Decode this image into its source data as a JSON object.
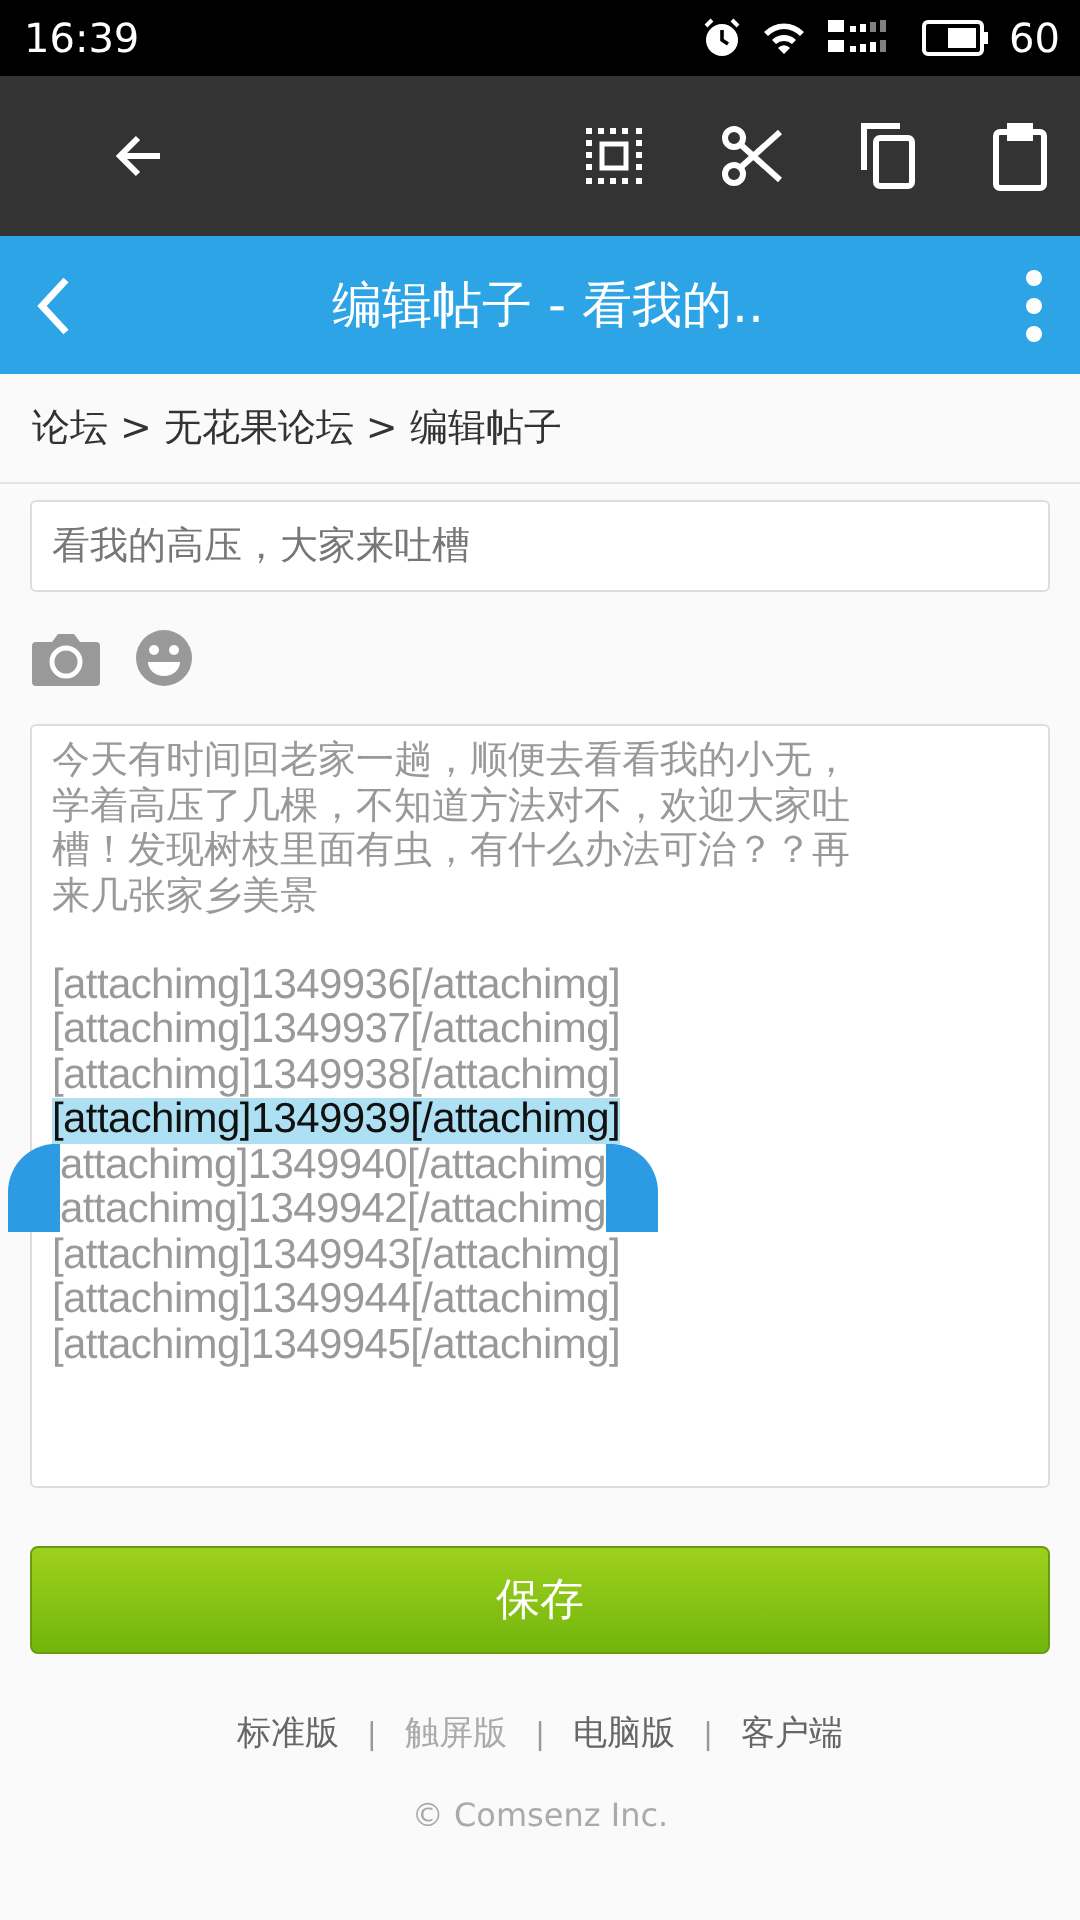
{
  "status_bar": {
    "time": "16:39",
    "battery": "60"
  },
  "header": {
    "title": "编辑帖子 - 看我的.."
  },
  "breadcrumb": {
    "separator": ">",
    "items": [
      "论坛",
      "无花果论坛",
      "编辑帖子"
    ]
  },
  "subject": {
    "value": "看我的高压，大家来吐槽"
  },
  "message": {
    "paragraph_lines": [
      "今天有时间回老家一趟，顺便去看看我的小无，",
      "学着高压了几棵，不知道方法对不，欢迎大家吐",
      "槽！发现树枝里面有虫，有什么办法可治？？再",
      "来几张家乡美景"
    ],
    "lines": [
      {
        "text": "[attachimg]1349936[/attachimg]",
        "selected": false,
        "handles": false
      },
      {
        "text": "[attachimg]1349937[/attachimg]",
        "selected": false,
        "handles": false
      },
      {
        "text": "[attachimg]1349938[/attachimg]",
        "selected": false,
        "handles": false
      },
      {
        "text": "[attachimg]1349939[/attachimg]",
        "selected": true,
        "handles": false
      },
      {
        "text": "attachimg]1349940[/attachimg",
        "selected": false,
        "handles": true
      },
      {
        "text": "attachimg]1349942[/attachimg",
        "selected": false,
        "handles": false
      },
      {
        "text": "[attachimg]1349943[/attachimg]",
        "selected": false,
        "handles": false
      },
      {
        "text": "[attachimg]1349944[/attachimg]",
        "selected": false,
        "handles": false
      },
      {
        "text": "[attachimg]1349945[/attachimg]",
        "selected": false,
        "handles": false
      }
    ]
  },
  "save_button": "保存",
  "footer": {
    "separator": "|",
    "links": [
      {
        "label": "标准版",
        "selected": false
      },
      {
        "label": "触屏版",
        "selected": true
      },
      {
        "label": "电脑版",
        "selected": false
      },
      {
        "label": "客户端",
        "selected": false
      }
    ],
    "copyright": "© Comsenz Inc."
  }
}
